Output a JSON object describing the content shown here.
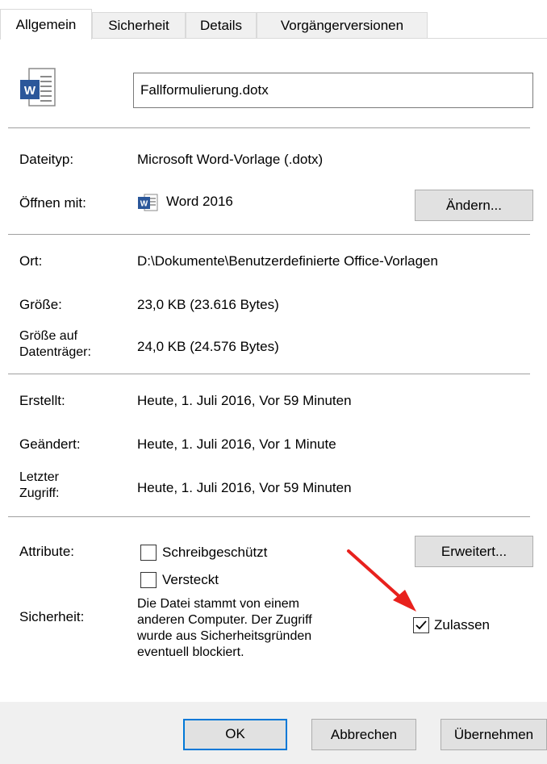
{
  "tabs": [
    "Allgemein",
    "Sicherheit",
    "Details",
    "Vorgängerversionen"
  ],
  "file": {
    "name": "Fallformulierung.dotx",
    "icon": "word-document-icon"
  },
  "type": {
    "label": "Dateityp:",
    "value": "Microsoft Word-Vorlage (.dotx)"
  },
  "opens_with": {
    "label": "Öffnen mit:",
    "app": "Word 2016",
    "change_button": "Ändern..."
  },
  "location": {
    "label": "Ort:",
    "value": "D:\\Dokumente\\Benutzerdefinierte Office-Vorlagen"
  },
  "size": {
    "label": "Größe:",
    "value": "23,0 KB (23.616 Bytes)"
  },
  "size_on_disk": {
    "label_line1": "Größe auf",
    "label_line2": "Datenträger:",
    "value": "24,0 KB (24.576 Bytes)"
  },
  "created": {
    "label": "Erstellt:",
    "value": "Heute, 1. Juli 2016, Vor 59 Minuten"
  },
  "modified": {
    "label": "Geändert:",
    "value": "Heute, 1. Juli 2016, Vor 1 Minute"
  },
  "accessed": {
    "label_line1": "Letzter",
    "label_line2": "Zugriff:",
    "value": "Heute, 1. Juli 2016, Vor 59 Minuten"
  },
  "attributes": {
    "label": "Attribute:",
    "readonly": "Schreibgeschützt",
    "hidden": "Versteckt",
    "advanced_button": "Erweitert..."
  },
  "security": {
    "label": "Sicherheit:",
    "lines": [
      "Die Datei stammt von einem",
      "anderen Computer. Der Zugriff",
      "wurde aus Sicherheitsgründen",
      "eventuell blockiert."
    ],
    "allow_label": "Zulassen",
    "allow_checked": true
  },
  "footer": {
    "ok": "OK",
    "cancel": "Abbrechen",
    "apply": "Übernehmen"
  },
  "colors": {
    "accent": "#0078d7",
    "arrow": "#e8211d",
    "word": "#2b579a"
  }
}
